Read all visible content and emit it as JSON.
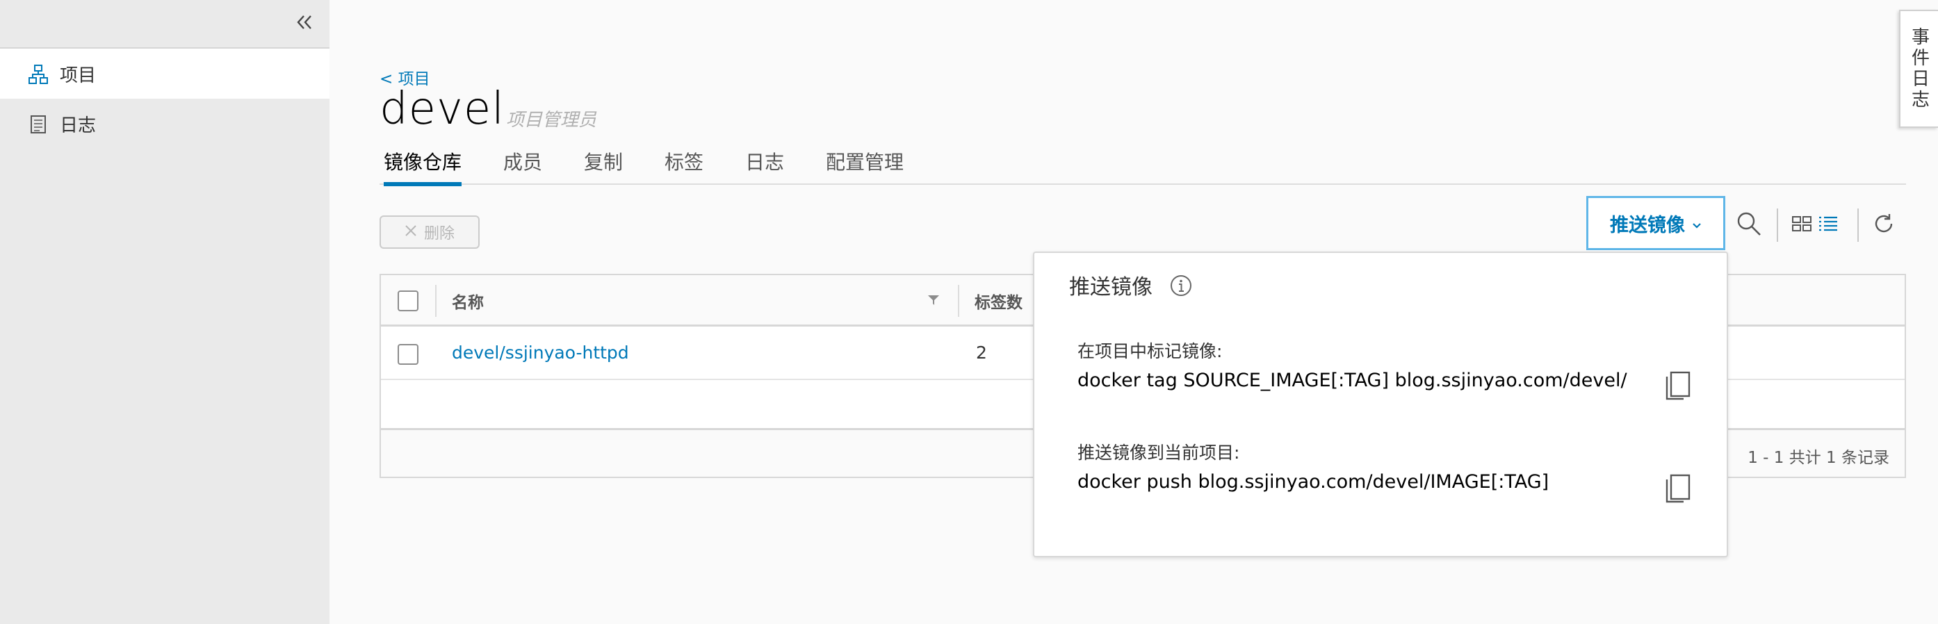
{
  "sidebar": {
    "items": [
      {
        "label": "项目",
        "icon": "project-icon",
        "active": true
      },
      {
        "label": "日志",
        "icon": "log-icon",
        "active": false
      }
    ]
  },
  "header": {
    "back_link": "< 项目",
    "project_name": "devel",
    "role": "项目管理员"
  },
  "tabs": [
    "镜像仓库",
    "成员",
    "复制",
    "标签",
    "日志",
    "配置管理"
  ],
  "toolbar": {
    "delete_label": "删除",
    "push_label": "推送镜像"
  },
  "table": {
    "columns": [
      "名称",
      "标签数"
    ],
    "rows": [
      {
        "name": "devel/ssjinyao-httpd",
        "tags": "2"
      }
    ],
    "footer": "1 - 1 共计 1 条记录"
  },
  "popover": {
    "title": "推送镜像",
    "tag_label": "在项目中标记镜像:",
    "tag_command": "docker tag SOURCE_IMAGE[:TAG] blog.ssjinyao.com/devel/",
    "push_label": "推送镜像到当前项目:",
    "push_command": "docker push blog.ssjinyao.com/devel/IMAGE[:TAG]"
  },
  "event_log": "事件日志",
  "colors": {
    "accent": "#0079b8",
    "sidebar_bg": "#eaeaea",
    "push_border": "#5fb6e8"
  }
}
